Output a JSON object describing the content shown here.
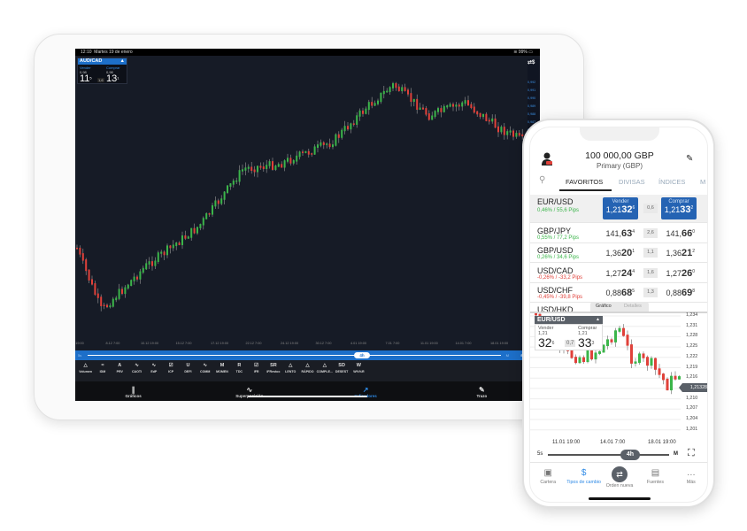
{
  "tablet": {
    "status": {
      "time": "12:10",
      "date": "Martes 19 de enero",
      "battery": "99%"
    },
    "quote": {
      "symbol": "AUD/CAD",
      "sell_label": "Vender",
      "buy_label": "Comprar",
      "sell_prefix": "0,98",
      "sell_big": "11",
      "sell_sup": "5",
      "buy_prefix": "0,98",
      "buy_big": "13",
      "buy_sup": "1",
      "spread": "1,6"
    },
    "symbol_button": "⇄$",
    "y_axis": [
      "0,992",
      "0,991",
      "0,990",
      "0,989",
      "0,988",
      "0,987",
      "0,986",
      "0,985",
      "0,984",
      "0,983"
    ],
    "x_axis": [
      "12 19:00",
      "8.12 7:00",
      "10.12 19:00",
      "15.12 7:00",
      "17.12 19:00",
      "22.12 7:00",
      "24.12 19:00",
      "30.12 7:00",
      "4.01 19:00",
      "7.01 7:00",
      "11.01 19:00",
      "14.01 7:00",
      "18.01 19:00"
    ],
    "slider": {
      "min": "5s",
      "value": "4h",
      "max": "M",
      "symbol": "Símbolo"
    },
    "tools": [
      {
        "g": "△",
        "l": "Volumen"
      },
      {
        "g": "≈",
        "l": "IDM"
      },
      {
        "g": "A",
        "l": "PRV"
      },
      {
        "g": "∿",
        "l": "CAOTI"
      },
      {
        "g": "∿",
        "l": "EdP"
      },
      {
        "g": "☑",
        "l": "ICP"
      },
      {
        "g": "U",
        "l": "DEFI"
      },
      {
        "g": "∿",
        "l": "COMM"
      },
      {
        "g": "M",
        "l": "MOMEN"
      },
      {
        "g": "R",
        "l": "TDC"
      },
      {
        "g": "☑",
        "l": "IFR"
      },
      {
        "g": "SR",
        "l": "IFRestoc"
      },
      {
        "g": "△",
        "l": "LENTO"
      },
      {
        "g": "△",
        "l": "RÁPIDO"
      },
      {
        "g": "△",
        "l": "COMPLE..."
      },
      {
        "g": "SD",
        "l": "DESEST"
      },
      {
        "g": "W",
        "l": "W%%R"
      }
    ],
    "tabs": [
      {
        "icon": "candles-icon",
        "g": "∥",
        "label": "Gráficos"
      },
      {
        "icon": "overlay-icon",
        "g": "∿",
        "label": "Superposición"
      },
      {
        "icon": "indicators-icon",
        "g": "↗",
        "label": "Indicadores",
        "active": true
      },
      {
        "icon": "pencil-icon",
        "g": "✎",
        "label": "Trazo"
      }
    ]
  },
  "phone": {
    "balance": "100 000,00 GBP",
    "account": "Primary (GBP)",
    "tabs": [
      "FAVORITOS",
      "DIVISAS",
      "ÍNDICES",
      "M"
    ],
    "sell_label": "Vender",
    "buy_label": "Comprar",
    "rows": [
      {
        "name": "EUR/USD",
        "change": "0,46% / 55,6 Pips",
        "dir": "pos",
        "bid_pre": "1,21",
        "bid_big": "32",
        "bid_sup": "6",
        "spread": "0,6",
        "ask_pre": "1,21",
        "ask_big": "33",
        "ask_sup": "2"
      },
      {
        "name": "GBP/JPY",
        "change": "0,55% / 77,2 Pips",
        "dir": "pos",
        "bid_pre": "141,",
        "bid_big": "63",
        "bid_sup": "4",
        "spread": "2,6",
        "ask_pre": "141,",
        "ask_big": "66",
        "ask_sup": "0"
      },
      {
        "name": "GBP/USD",
        "change": "0,26% / 34,6 Pips",
        "dir": "pos",
        "bid_pre": "1,36",
        "bid_big": "20",
        "bid_sup": "1",
        "spread": "1,1",
        "ask_pre": "1,36",
        "ask_big": "21",
        "ask_sup": "2"
      },
      {
        "name": "USD/CAD",
        "change": "-0,26% / -33,2 Pips",
        "dir": "neg",
        "bid_pre": "1,27",
        "bid_big": "24",
        "bid_sup": "4",
        "spread": "1,6",
        "ask_pre": "1,27",
        "ask_big": "26",
        "ask_sup": "0"
      },
      {
        "name": "USD/CHF",
        "change": "-0,45% / -39,8 Pips",
        "dir": "neg",
        "bid_pre": "0,88",
        "bid_big": "68",
        "bid_sup": "5",
        "spread": "1,3",
        "ask_pre": "0,88",
        "ask_big": "69",
        "ask_sup": "8"
      },
      {
        "name": "USD/HKD"
      }
    ],
    "chart_tabs": [
      "Gráfico",
      "Detalles"
    ],
    "chart_quote": {
      "symbol": "EUR/USD",
      "sell_label": "Vender",
      "buy_label": "Comprar",
      "sell_prefix": "1,21",
      "sell_big": "32",
      "sell_sup": "6",
      "buy_prefix": "1,21",
      "buy_big": "33",
      "buy_sup": "3",
      "spread": "0,7"
    },
    "y_axis": [
      "1,234",
      "1,231",
      "1,228",
      "1,225",
      "1,222",
      "1,219",
      "1,216",
      "1,213",
      "1,210",
      "1,207",
      "1,204",
      "1,201"
    ],
    "current_price": "1,21328",
    "x_axis": [
      "11.01 19:00",
      "14.01 7:00",
      "18.01 19:00"
    ],
    "slider": {
      "min": "5s",
      "value": "4h",
      "max": "M"
    },
    "nav": [
      {
        "icon": "briefcase-icon",
        "g": "▣",
        "label": "Cartera"
      },
      {
        "icon": "exchange-rates-icon",
        "g": "$",
        "label": "Tipos de cambio",
        "active": true
      },
      {
        "icon": "new-order-icon",
        "g": "⇄",
        "label": "Orden nueva",
        "circle": true
      },
      {
        "icon": "news-icon",
        "g": "▤",
        "label": "Fuentes"
      },
      {
        "icon": "more-icon",
        "g": "…",
        "label": "Más"
      }
    ]
  },
  "colors": {
    "accent": "#1d6fc9",
    "up": "#3bb54a",
    "down": "#e0413a"
  }
}
